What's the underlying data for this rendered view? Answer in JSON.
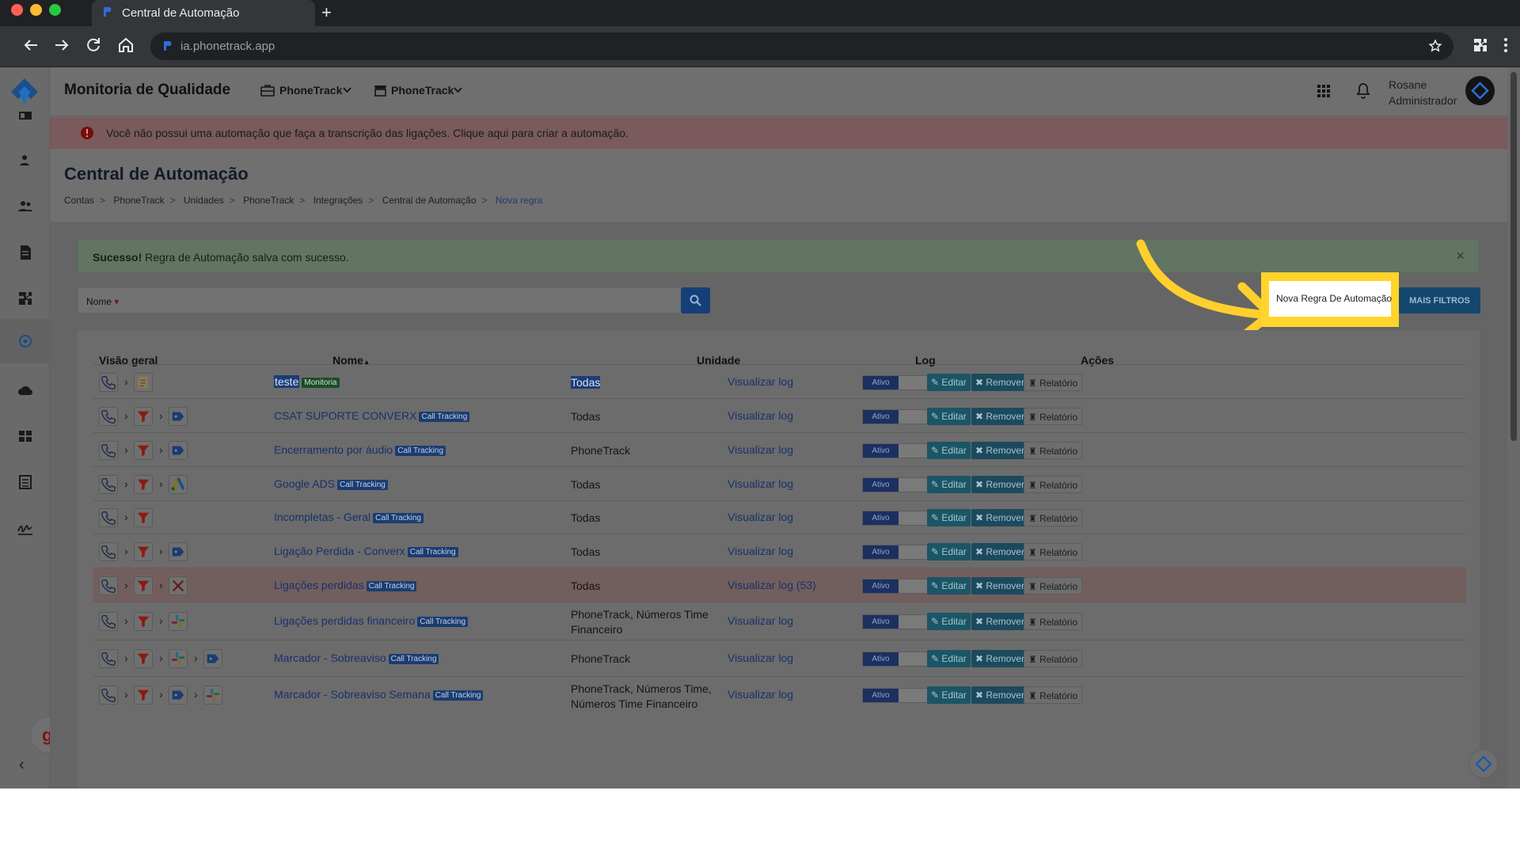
{
  "browser": {
    "tab_title": "Central de Automação",
    "new_tab_symbol": "+",
    "url": "ia.phonetrack.app",
    "traffic_colors": [
      "#ff5f57",
      "#febc2e",
      "#28c840"
    ]
  },
  "header": {
    "title": "Monitoria de Qualidade",
    "dropdowns": [
      {
        "label": "PhoneTrack",
        "icon": "briefcase-icon"
      },
      {
        "label": "PhoneTrack",
        "icon": "store-icon"
      }
    ],
    "user_name": "Rosane",
    "user_role": "Administrador"
  },
  "alert": {
    "text": "Você não possui uma automação que faça a transcrição das ligações. Clique aqui para criar a automação."
  },
  "page": {
    "title": "Central de Automação",
    "breadcrumbs": [
      "Contas",
      "PhoneTrack",
      "Unidades",
      "PhoneTrack",
      "Integrações",
      "Central de Automação",
      "Nova regra"
    ],
    "crumb_separator": ">"
  },
  "success": {
    "strong": "Sucesso!",
    "text": " Regra de Automação salva com sucesso.",
    "close_symbol": "×"
  },
  "search": {
    "field_select": "Nome",
    "caret": "▾"
  },
  "buttons": {
    "new_rule": "Nova Regra De Automação",
    "more_filters": "MAIS FILTROS"
  },
  "table": {
    "headers": {
      "overview": "Visão geral",
      "name": "Nome",
      "name_sort": "▴",
      "unit": "Unidade",
      "log": "Log",
      "actions": "Ações"
    },
    "toggle_label": "Ativo",
    "edit_label": "✎ Editar",
    "remove_label": "✖ Remover",
    "report_label": "♜ Relatório",
    "chevron": "›",
    "rows": [
      {
        "name": "teste",
        "badge": "Monitoria",
        "unit": "Todas",
        "log": "Visualizar log",
        "icons": [
          "phone-icon",
          "notes-icon"
        ]
      },
      {
        "name": "CSAT SUPORTE CONVERX",
        "badge": "Call Tracking",
        "unit": "Todas",
        "log": "Visualizar log",
        "icons": [
          "phone-icon",
          "filter-icon",
          "tag-icon"
        ]
      },
      {
        "name": "Encerramento por áudio",
        "badge": "Call Tracking",
        "unit": "PhoneTrack",
        "log": "Visualizar log",
        "icons": [
          "phone-icon",
          "filter-icon",
          "tag-icon"
        ]
      },
      {
        "name": "Google ADS",
        "badge": "Call Tracking",
        "unit": "Todas",
        "log": "Visualizar log",
        "icons": [
          "phone-icon",
          "filter-icon",
          "google-ads-icon"
        ]
      },
      {
        "name": "Incompletas - Geral",
        "badge": "Call Tracking",
        "unit": "Todas",
        "log": "Visualizar log",
        "icons": [
          "phone-icon",
          "filter-icon"
        ]
      },
      {
        "name": "Ligação Perdida - Converx",
        "badge": "Call Tracking",
        "unit": "Todas",
        "log": "Visualizar log",
        "icons": [
          "phone-icon",
          "filter-icon",
          "tag-icon"
        ]
      },
      {
        "name": "Ligações perdidas",
        "badge": "Call Tracking",
        "unit": "Todas",
        "log": "Visualizar log (53)",
        "icons": [
          "phone-icon",
          "filter-icon",
          "tools-icon"
        ]
      },
      {
        "name": "Ligações perdidas financeiro",
        "badge": "Call Tracking",
        "unit": "PhoneTrack, Números Time Financeiro",
        "log": "Visualizar log",
        "icons": [
          "phone-icon",
          "filter-icon",
          "slack-icon"
        ]
      },
      {
        "name": "Marcador - Sobreaviso",
        "badge": "Call Tracking",
        "unit": "PhoneTrack",
        "log": "Visualizar log",
        "icons": [
          "phone-icon",
          "filter-icon",
          "slack-icon",
          "tag-icon"
        ]
      },
      {
        "name": "Marcador - Sobreaviso Semana",
        "badge": "Call Tracking",
        "unit": "PhoneTrack, Números Time, Números Time Financeiro",
        "log": "Visualizar log",
        "icons": [
          "phone-icon",
          "filter-icon",
          "tag-icon",
          "slack-icon"
        ]
      }
    ]
  },
  "widgets": {
    "g_letter": "g.",
    "collapse_symbol": "‹"
  },
  "colors": {
    "highlight": "#ffd42b",
    "arrow": "#ffcf2e",
    "primary": "#163f78"
  }
}
